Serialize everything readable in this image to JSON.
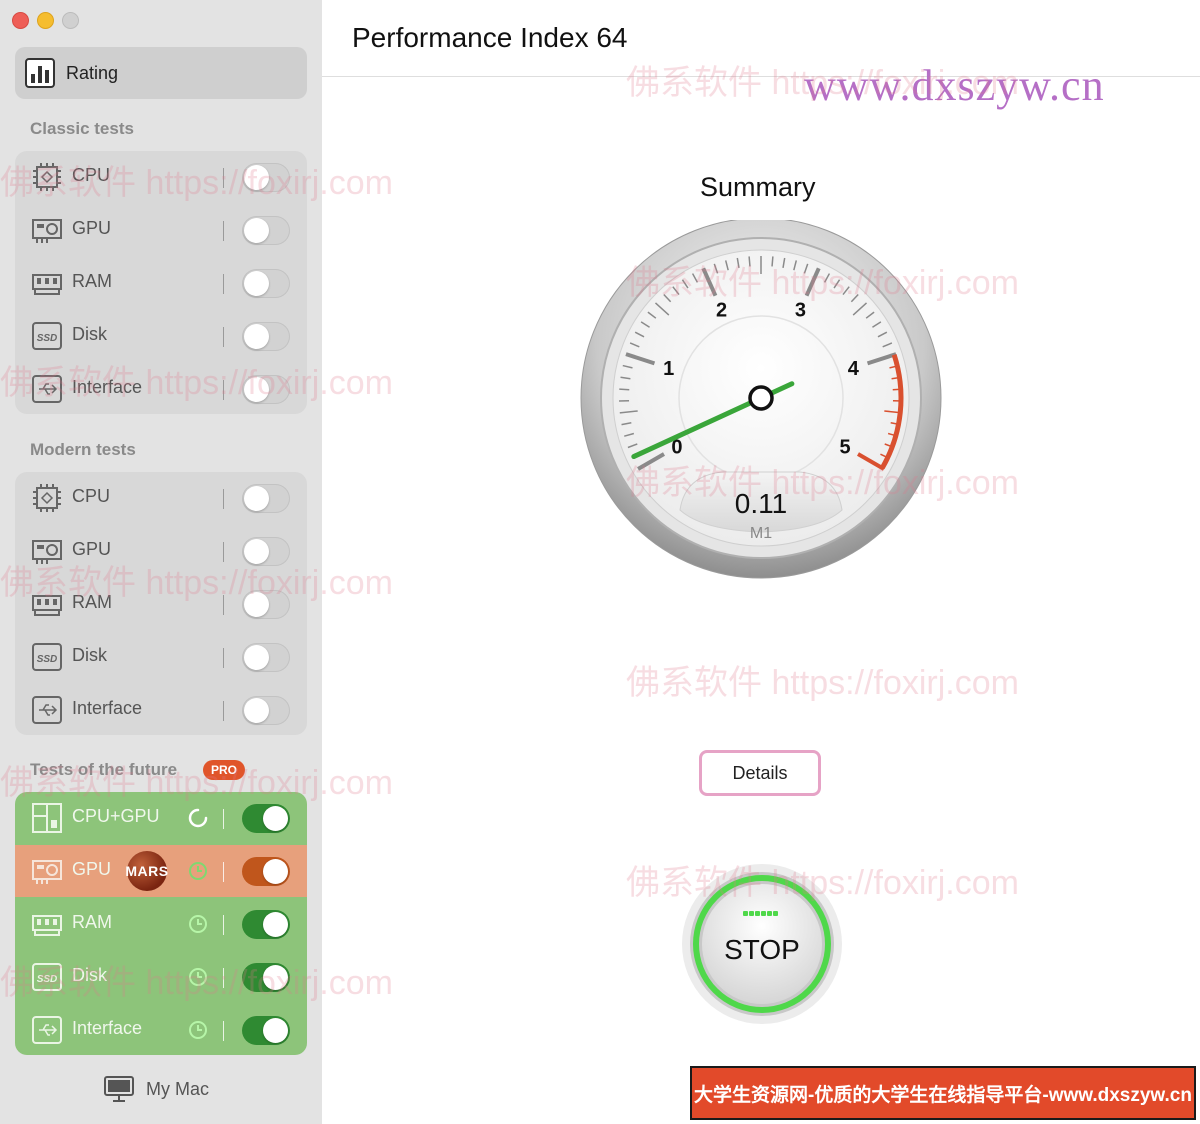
{
  "sidebar": {
    "rating_label": "Rating",
    "classic": {
      "title": "Classic tests",
      "items": [
        {
          "label": "CPU",
          "icon": "cpu-icon",
          "enabled": false
        },
        {
          "label": "GPU",
          "icon": "gpu-icon",
          "enabled": false
        },
        {
          "label": "RAM",
          "icon": "ram-icon",
          "enabled": false
        },
        {
          "label": "Disk",
          "icon": "disk-icon",
          "enabled": false
        },
        {
          "label": "Interface",
          "icon": "usb-icon",
          "enabled": false
        }
      ]
    },
    "modern": {
      "title": "Modern tests",
      "items": [
        {
          "label": "CPU",
          "icon": "cpu-icon",
          "enabled": false
        },
        {
          "label": "GPU",
          "icon": "gpu-icon",
          "enabled": false
        },
        {
          "label": "RAM",
          "icon": "ram-icon",
          "enabled": false
        },
        {
          "label": "Disk",
          "icon": "disk-icon",
          "enabled": false
        },
        {
          "label": "Interface",
          "icon": "usb-icon",
          "enabled": false
        }
      ]
    },
    "future": {
      "title": "Tests of the future",
      "badge": "PRO",
      "items": [
        {
          "label": "CPU+GPU",
          "status": "running",
          "enabled": true
        },
        {
          "label": "GPU",
          "tag": "MARS",
          "status": "queued",
          "enabled": true,
          "highlight": true
        },
        {
          "label": "RAM",
          "status": "queued",
          "enabled": true
        },
        {
          "label": "Disk",
          "status": "queued",
          "enabled": true
        },
        {
          "label": "Interface",
          "status": "queued",
          "enabled": true
        }
      ]
    },
    "footer_label": "My Mac"
  },
  "main": {
    "title": "Performance Index 64",
    "summary_title": "Summary",
    "gauge": {
      "value": "0.11",
      "value_numeric": 0.11,
      "min": 0,
      "max": 5,
      "ticks": [
        "0",
        "1",
        "2",
        "3",
        "4",
        "5"
      ],
      "device": "M1",
      "needle_color": "#3aa63a",
      "redline_color": "#d9502f"
    },
    "details_label": "Details",
    "stop_label": "STOP"
  },
  "watermarks": {
    "site": "www.dxszyw.cn",
    "text": "佛系软件 https://foxirj.com",
    "banner": "大学生资源网-优质的大学生在线指导平台-www.dxszyw.cn"
  },
  "colors": {
    "sidebar_bg": "#e3e3e3",
    "future_bg": "#8dc47a",
    "toggle_on": "#2f8a32",
    "highlight_row": "#e7a07c",
    "pro_badge": "#e0552a",
    "stop_ring": "#4fd84a"
  }
}
